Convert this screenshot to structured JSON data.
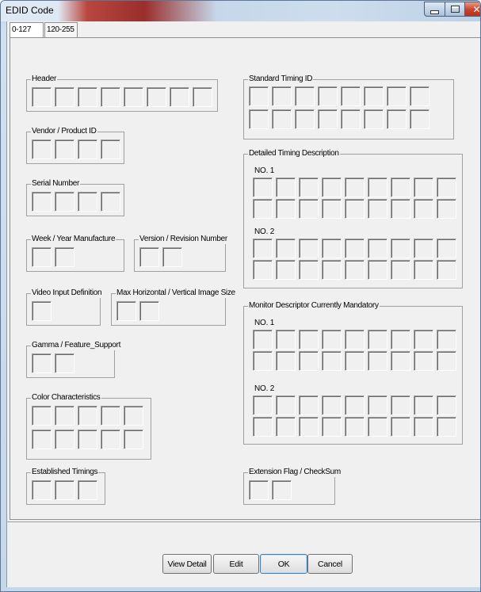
{
  "window": {
    "title": "EDID Code"
  },
  "tabs": [
    {
      "label": "0-127",
      "selected": true
    },
    {
      "label": "120-255",
      "selected": false
    }
  ],
  "groups": {
    "header": {
      "label": "Header"
    },
    "vendor_product_id": {
      "label": "Vendor / Product ID"
    },
    "serial_number": {
      "label": "Serial Number"
    },
    "week_year": {
      "label": "Week / Year Manufacture"
    },
    "version_revision": {
      "label": "Version / Revision Number"
    },
    "video_input": {
      "label": "Video Input Definition"
    },
    "max_image_size": {
      "label": "Max Horizontal / Vertical Image Size"
    },
    "gamma_feature": {
      "label": "Gamma / Feature_Support"
    },
    "color_characteristics": {
      "label": "Color Characteristics"
    },
    "established_timings": {
      "label": "Established Timings"
    },
    "standard_timing": {
      "label": "Standard Timing ID"
    },
    "detailed_timing": {
      "label": "Detailed Timing Description",
      "no1": "NO. 1",
      "no2": "NO. 2"
    },
    "monitor_descriptor": {
      "label": "Monitor Descriptor Currently Mandatory",
      "no1": "NO. 1",
      "no2": "NO. 2"
    },
    "extension_checksum": {
      "label": "Extension Flag / CheckSum"
    }
  },
  "buttons": {
    "view_detail": "View Detail",
    "edit": "Edit",
    "ok": "OK",
    "cancel": "Cancel"
  }
}
